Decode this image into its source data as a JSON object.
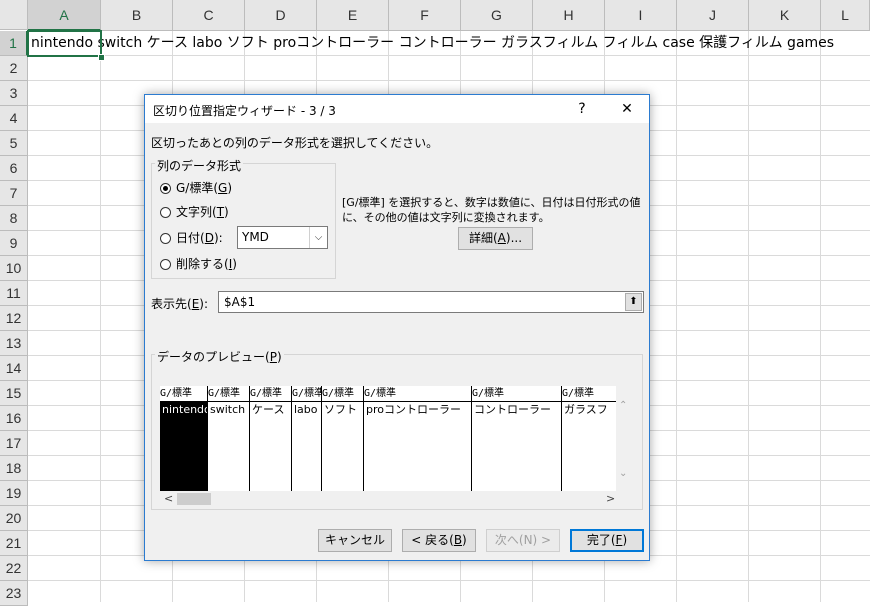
{
  "sheet": {
    "columns": [
      "A",
      "B",
      "C",
      "D",
      "E",
      "F",
      "G",
      "H",
      "I",
      "J",
      "K",
      "L"
    ],
    "rows": [
      "1",
      "2",
      "3",
      "4",
      "5",
      "6",
      "7",
      "8",
      "9",
      "10",
      "11",
      "12",
      "13",
      "14",
      "15",
      "16",
      "17",
      "18",
      "19",
      "20",
      "21",
      "22",
      "23"
    ],
    "row1_text": "nintendo switch ケース labo ソフト proコントローラー コントローラー ガラスフィルム フィルム case 保護フィルム games"
  },
  "dialog": {
    "title": "区切り位置指定ウィザード - 3 / 3",
    "help": "?",
    "close": "✕",
    "description": "区切ったあとの列のデータ形式を選択してください。",
    "format_group": "列のデータ形式",
    "radios": [
      {
        "pre": "G/標準(",
        "key": "G",
        "post": ")",
        "checked": true
      },
      {
        "pre": "文字列(",
        "key": "T",
        "post": ")",
        "checked": false
      },
      {
        "pre": "日付(",
        "key": "D",
        "post": "):",
        "checked": false
      },
      {
        "pre": "削除する(",
        "key": "I",
        "post": ")",
        "checked": false
      }
    ],
    "date_format": "YMD",
    "info_text": "[G/標準] を選択すると、数字は数値に、日付は日付形式の値に、その他の値は文字列に変換されます。",
    "advanced_pre": "詳細(",
    "advanced_key": "A",
    "advanced_post": ")...",
    "destination_pre": "表示先(",
    "destination_key": "E",
    "destination_post": "):",
    "destination_value": "$A$1",
    "preview_label_pre": "データのプレビュー(",
    "preview_label_key": "P",
    "preview_label_post": ")",
    "preview_headers": [
      "G/標準",
      "G/標準",
      "G/標準",
      "G/標準",
      "G/標準",
      "G/標準",
      "G/標準",
      "G/標準"
    ],
    "preview_values": [
      "nintendo",
      "switch",
      "ケース",
      "labo",
      "ソフト",
      "proコントローラー",
      "コントローラー",
      "ガラスフ"
    ],
    "buttons": {
      "cancel": "キャンセル",
      "back_pre": "< 戻る(",
      "back_key": "B",
      "back_post": ")",
      "next": "次へ(N) >",
      "finish_pre": "完了(",
      "finish_key": "F",
      "finish_post": ")"
    }
  }
}
